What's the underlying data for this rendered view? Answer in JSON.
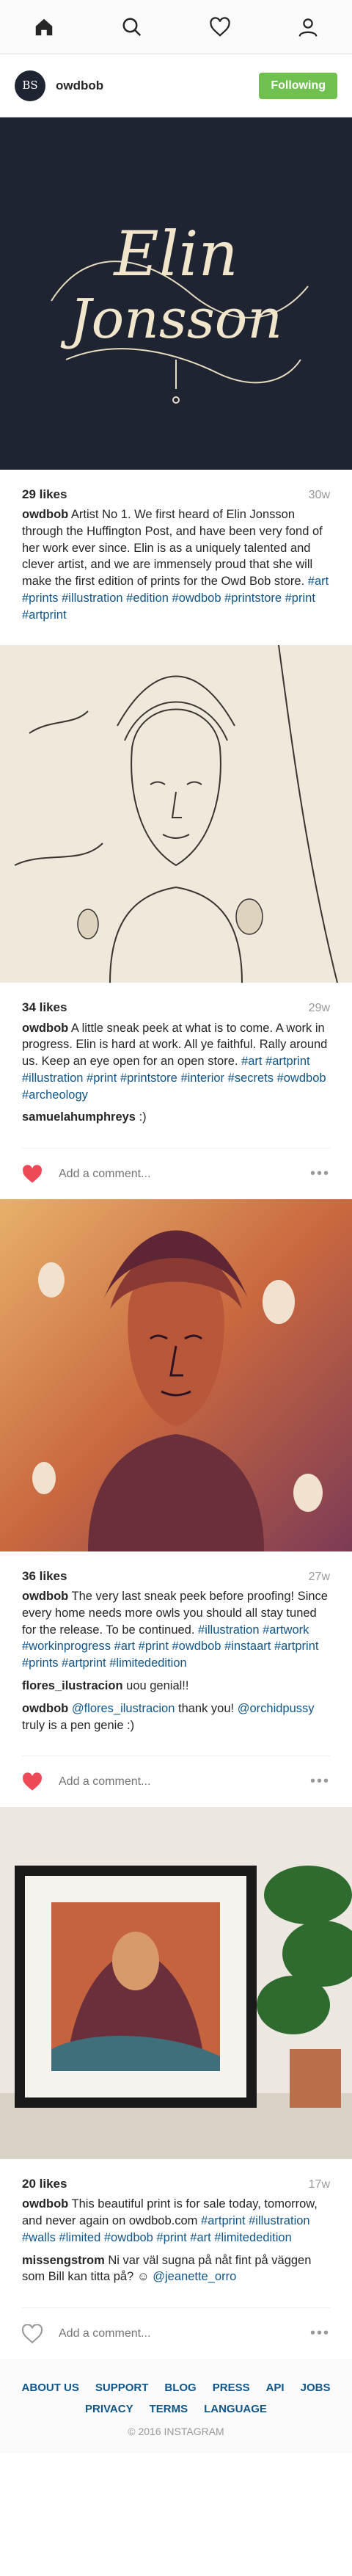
{
  "nav": {
    "icons": [
      "home-icon",
      "search-icon",
      "heart-icon",
      "profile-icon"
    ]
  },
  "profile": {
    "avatar_text": "BS",
    "username": "owdbob",
    "follow_label": "Following"
  },
  "posts": [
    {
      "image_text_1": "Elin",
      "image_text_2": "Jonsson",
      "likes": "29 likes",
      "time": "30w",
      "caption_user": "owdbob",
      "caption_text": "Artist No 1. We first heard of Elin Jonsson through the Huffington Post, and have been very fond of her work ever since. Elin is as a uniquely talented and clever artist, and we are immensely proud that she will make the first edition of prints for the Owd Bob store.",
      "caption_tags": "#art #prints #illustration #edition #owdbob #printstore #print #artprint"
    },
    {
      "likes": "34 likes",
      "time": "29w",
      "caption_user": "owdbob",
      "caption_text": "A little sneak peek at what is to come. A work in progress. Elin is hard at work. All ye faithful. Rally around us. Keep an eye open for an open store.",
      "caption_tags": "#art #artprint #illustration #print #printstore #interior #secrets #owdbob #archeology",
      "comments": [
        {
          "user": "samuelahumphreys",
          "text": ":)"
        }
      ],
      "comment_placeholder": "Add a comment...",
      "more_label": "•••"
    },
    {
      "likes": "36 likes",
      "time": "27w",
      "caption_user": "owdbob",
      "caption_text": "The very last sneak peek before proofing! Since every home needs more owls you should all stay tuned for the release. To be continued.",
      "caption_tags": "#illustration #artwork #workinprogress #art #print #owdbob #instaart #artprint #prints #artprint #limitededition",
      "comments": [
        {
          "user": "flores_ilustracion",
          "text": "uou genial!!"
        },
        {
          "user": "owdbob",
          "mention": "@flores_ilustracion",
          "text": "thank you!",
          "mention2": "@orchidpussy",
          "text2": "truly is a pen genie :)"
        }
      ],
      "comment_placeholder": "Add a comment...",
      "more_label": "•••"
    },
    {
      "likes": "20 likes",
      "time": "17w",
      "caption_user": "owdbob",
      "caption_text": "This beautiful print is for sale today, tomorrow, and never again on owdbob.com",
      "caption_tags": "#artprint #illustration #walls #limited #owdbob #print #art #limitededition",
      "comments": [
        {
          "user": "missengstrom",
          "text": "Ni var väl sugna på nåt fint på väggen som Bill kan titta på? ☺",
          "mention": "@jeanette_orro"
        }
      ],
      "comment_placeholder": "Add a comment...",
      "more_label": "•••"
    }
  ],
  "footer": {
    "links": [
      "About us",
      "Support",
      "Blog",
      "Press",
      "API",
      "Jobs",
      "Privacy",
      "Terms",
      "Language"
    ],
    "copyright": "© 2016 INSTAGRAM"
  },
  "colors": {
    "accent_green": "#70c050",
    "link_blue": "#125688",
    "heart_red": "#ed4956",
    "navy": "#1f2433"
  }
}
